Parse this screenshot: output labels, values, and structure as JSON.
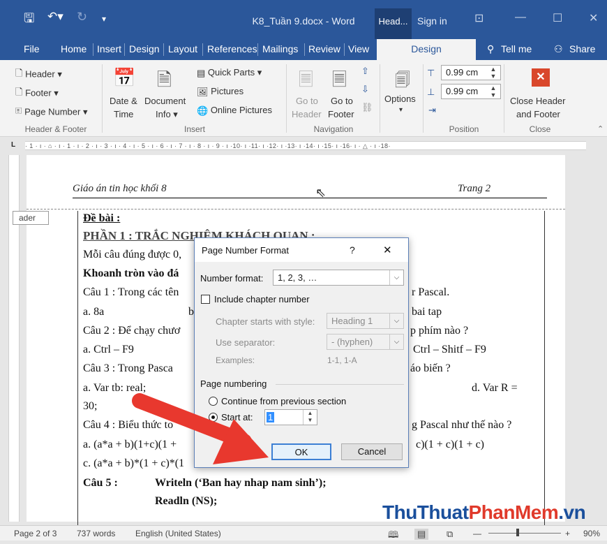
{
  "titlebar": {
    "title": "K8_Tuần 9.docx - Word",
    "context_tab": "Head...",
    "signin": "Sign in"
  },
  "tabs": [
    "File",
    "Home",
    "Insert",
    "Design",
    "Layout",
    "References",
    "Mailings",
    "Review",
    "View"
  ],
  "active_tab": "Design",
  "tell_me": "Tell me",
  "share": "Share",
  "ribbon": {
    "hf": {
      "header": "Header",
      "footer": "Footer",
      "page_number": "Page Number",
      "label": "Header & Footer"
    },
    "insert": {
      "date_time_1": "Date &",
      "date_time_2": "Time",
      "doc_info_1": "Document",
      "doc_info_2": "Info",
      "quick_parts": "Quick Parts",
      "pictures": "Pictures",
      "online_pictures": "Online Pictures",
      "label": "Insert"
    },
    "nav": {
      "goto_header_1": "Go to",
      "goto_header_2": "Header",
      "goto_footer_1": "Go to",
      "goto_footer_2": "Footer",
      "label": "Navigation"
    },
    "options": {
      "label_btn": "Options"
    },
    "position": {
      "header_pos": "0.99 cm",
      "footer_pos": "0.99 cm",
      "label": "Position"
    },
    "close": {
      "btn_1": "Close Header",
      "btn_2": "and Footer",
      "label": "Close"
    }
  },
  "ruler_text": "· 1 · ı · ⌂ · ı · 1 · ı · 2 · ı · 3 · ı · 4 · ı · 5 · ı · 6 · ı · 7 · ı · 8 · ı · 9 · ı ·10· ı ·11· ı ·12· ı ·13· ı ·14· ı ·15· ı ·16· ı · △ · ı ·18·",
  "document": {
    "header_left": "Giáo án tin học khối 8",
    "header_right": "Trang 2",
    "header_tag": "ader",
    "lines": [
      "Đề bài :",
      "PHẦN 1 : TRẮC NGHIỆM KHÁCH QUAN :",
      "Mỗi câu đúng được 0,",
      "Khoanh tròn vào đá",
      "Câu 1 : Trong các tên",
      "r Pascal.",
      "a. 8a",
      "b",
      "bai tap",
      "Câu 2 : Để chạy chươ",
      "p phím nào  ?",
      "a. Ctrl – F9",
      "Ctrl – Shitf – F9",
      "Câu 3 :  Trong Pasca",
      "áo biến ?",
      "a. Var  tb: real;",
      "d. Var  R =",
      "30;",
      "Câu 4 : Biểu thức to",
      "g Pascal như thế nào ?",
      "a. (a*a + b)(1+c)(1 +",
      "c)(1 + c)(1 + c)",
      "c. (a*a + b)*(1 + c)*(1",
      "Câu 5 :",
      "Writeln (‘Ban hay nhap nam sinh’);",
      "Readln (NS);"
    ]
  },
  "dialog": {
    "title": "Page Number Format",
    "help": "?",
    "close": "✕",
    "number_format_label": "Number format:",
    "number_format_value": "1, 2, 3, …",
    "include_chapter": "Include chapter number",
    "chapter_style_label": "Chapter starts with style:",
    "chapter_style_value": "Heading 1",
    "separator_label": "Use separator:",
    "separator_value": "-  (hyphen)",
    "examples_label": "Examples:",
    "examples_value": "1-1, 1-A",
    "page_numbering": "Page numbering",
    "continue_label": "Continue from previous section",
    "start_at_label": "Start at:",
    "start_at_value": "1",
    "ok": "OK",
    "cancel": "Cancel"
  },
  "status": {
    "page": "Page 2 of 3",
    "words": "737 words",
    "language": "English (United States)",
    "zoom": "90%"
  },
  "watermark": {
    "part1": "ThuThuat",
    "part2": "PhanMem",
    "part3": ".vn"
  }
}
